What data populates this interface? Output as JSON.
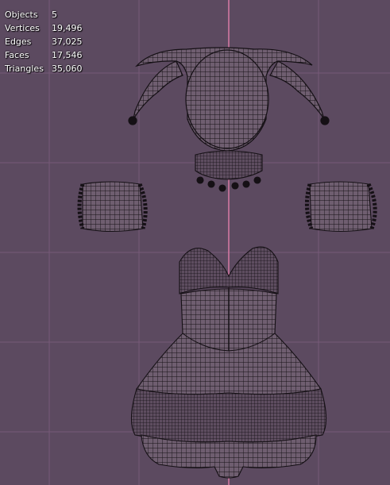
{
  "viewport": {
    "background": "#5c4a60",
    "grid_color": "#7d5e7f",
    "axis_color": "#d87aa6",
    "wire_color": "#151015",
    "fill_color": "#6f5e70"
  },
  "stats": [
    {
      "label": "Objects",
      "value": "5"
    },
    {
      "label": "Vertices",
      "value": "19,496"
    },
    {
      "label": "Edges",
      "value": "37,025"
    },
    {
      "label": "Faces",
      "value": "17,546"
    },
    {
      "label": "Triangles",
      "value": "35,060"
    }
  ],
  "objects": [
    {
      "name": "jester-hat",
      "icon": "wireframe-mesh"
    },
    {
      "name": "collar",
      "icon": "wireframe-mesh"
    },
    {
      "name": "cuff-left",
      "icon": "wireframe-mesh"
    },
    {
      "name": "cuff-right",
      "icon": "wireframe-mesh"
    },
    {
      "name": "dress",
      "icon": "wireframe-mesh"
    }
  ]
}
